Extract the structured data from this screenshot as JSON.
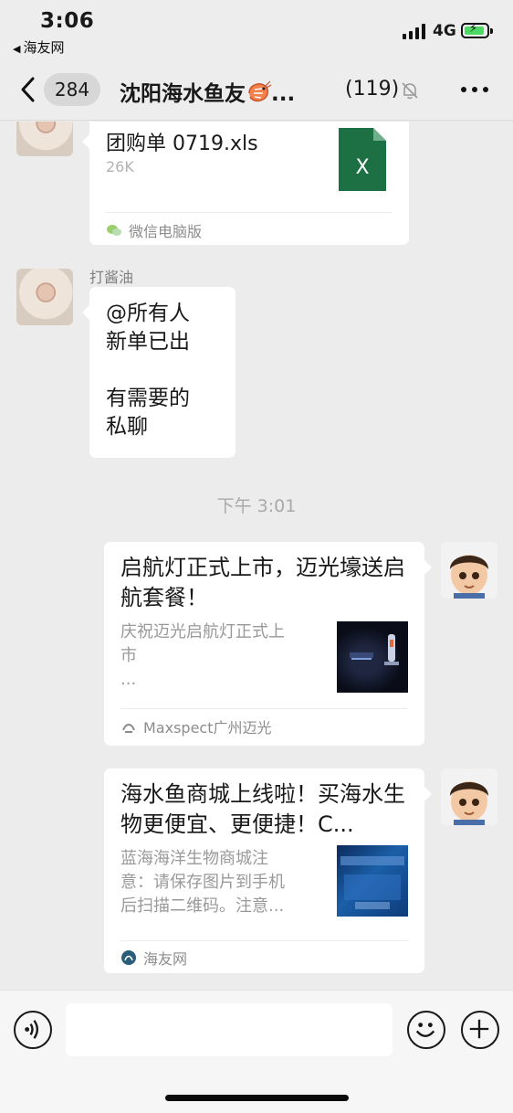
{
  "status_bar": {
    "time": "3:06",
    "back_app": "海友网",
    "network": "4G"
  },
  "nav": {
    "unread_count": "284",
    "title": "沈阳海水鱼友",
    "title_suffix": "...",
    "members": "(119)"
  },
  "messages": {
    "file": {
      "name": "团购单 0719.xls",
      "size": "26K",
      "icon_label": "X",
      "source": "微信电脑版"
    },
    "text": {
      "sender": "打酱油",
      "body": "@所有人\n新单已出\n\n有需要的\n私聊"
    },
    "timestamp": "下午 3:01",
    "card1": {
      "title": "启航灯正式上市，迈光壕送启航套餐！",
      "desc": "庆祝迈光启航灯正式上\n市\n...",
      "source": "Maxspect广州迈光"
    },
    "card2": {
      "title": "海水鱼商城上线啦！买海水生物更便宜、更便捷！C...",
      "desc": "蓝海海洋生物商城注\n意：请保存图片到手机\n后扫描二维码。注意...",
      "source": "海友网"
    }
  },
  "colors": {
    "excel_green": "#1d7044",
    "battery_green": "#4cd964",
    "background": "#ececec"
  }
}
